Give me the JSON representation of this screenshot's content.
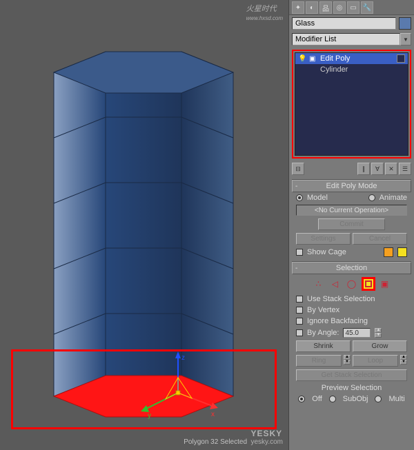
{
  "object_name": "Glass",
  "modifier_dropdown": "Modifier List",
  "stack": {
    "items": [
      "Edit Poly",
      "Cylinder"
    ]
  },
  "rollouts": {
    "edit_poly_mode": {
      "title": "Edit Poly Mode",
      "model": "Model",
      "animate": "Animate",
      "no_op": "<No Current Operation>",
      "commit": "Commit",
      "settings": "Settings",
      "cancel": "Cancel",
      "show_cage": "Show Cage"
    },
    "selection": {
      "title": "Selection",
      "use_stack": "Use Stack Selection",
      "by_vertex": "By Vertex",
      "ignore_backfacing": "Ignore Backfacing",
      "by_angle": "By Angle:",
      "angle_value": "45.0",
      "shrink": "Shrink",
      "grow": "Grow",
      "ring": "Ring",
      "loop": "Loop",
      "get_stack": "Get Stack Selection",
      "preview": "Preview Selection",
      "off": "Off",
      "subobj": "SubObj",
      "multi": "Multi",
      "status": "Polygon 32 Selected"
    }
  },
  "overlay": {
    "watermark_site": "yesky.com",
    "top_logo": "火星时代",
    "top_url": "www.hxsd.com"
  }
}
